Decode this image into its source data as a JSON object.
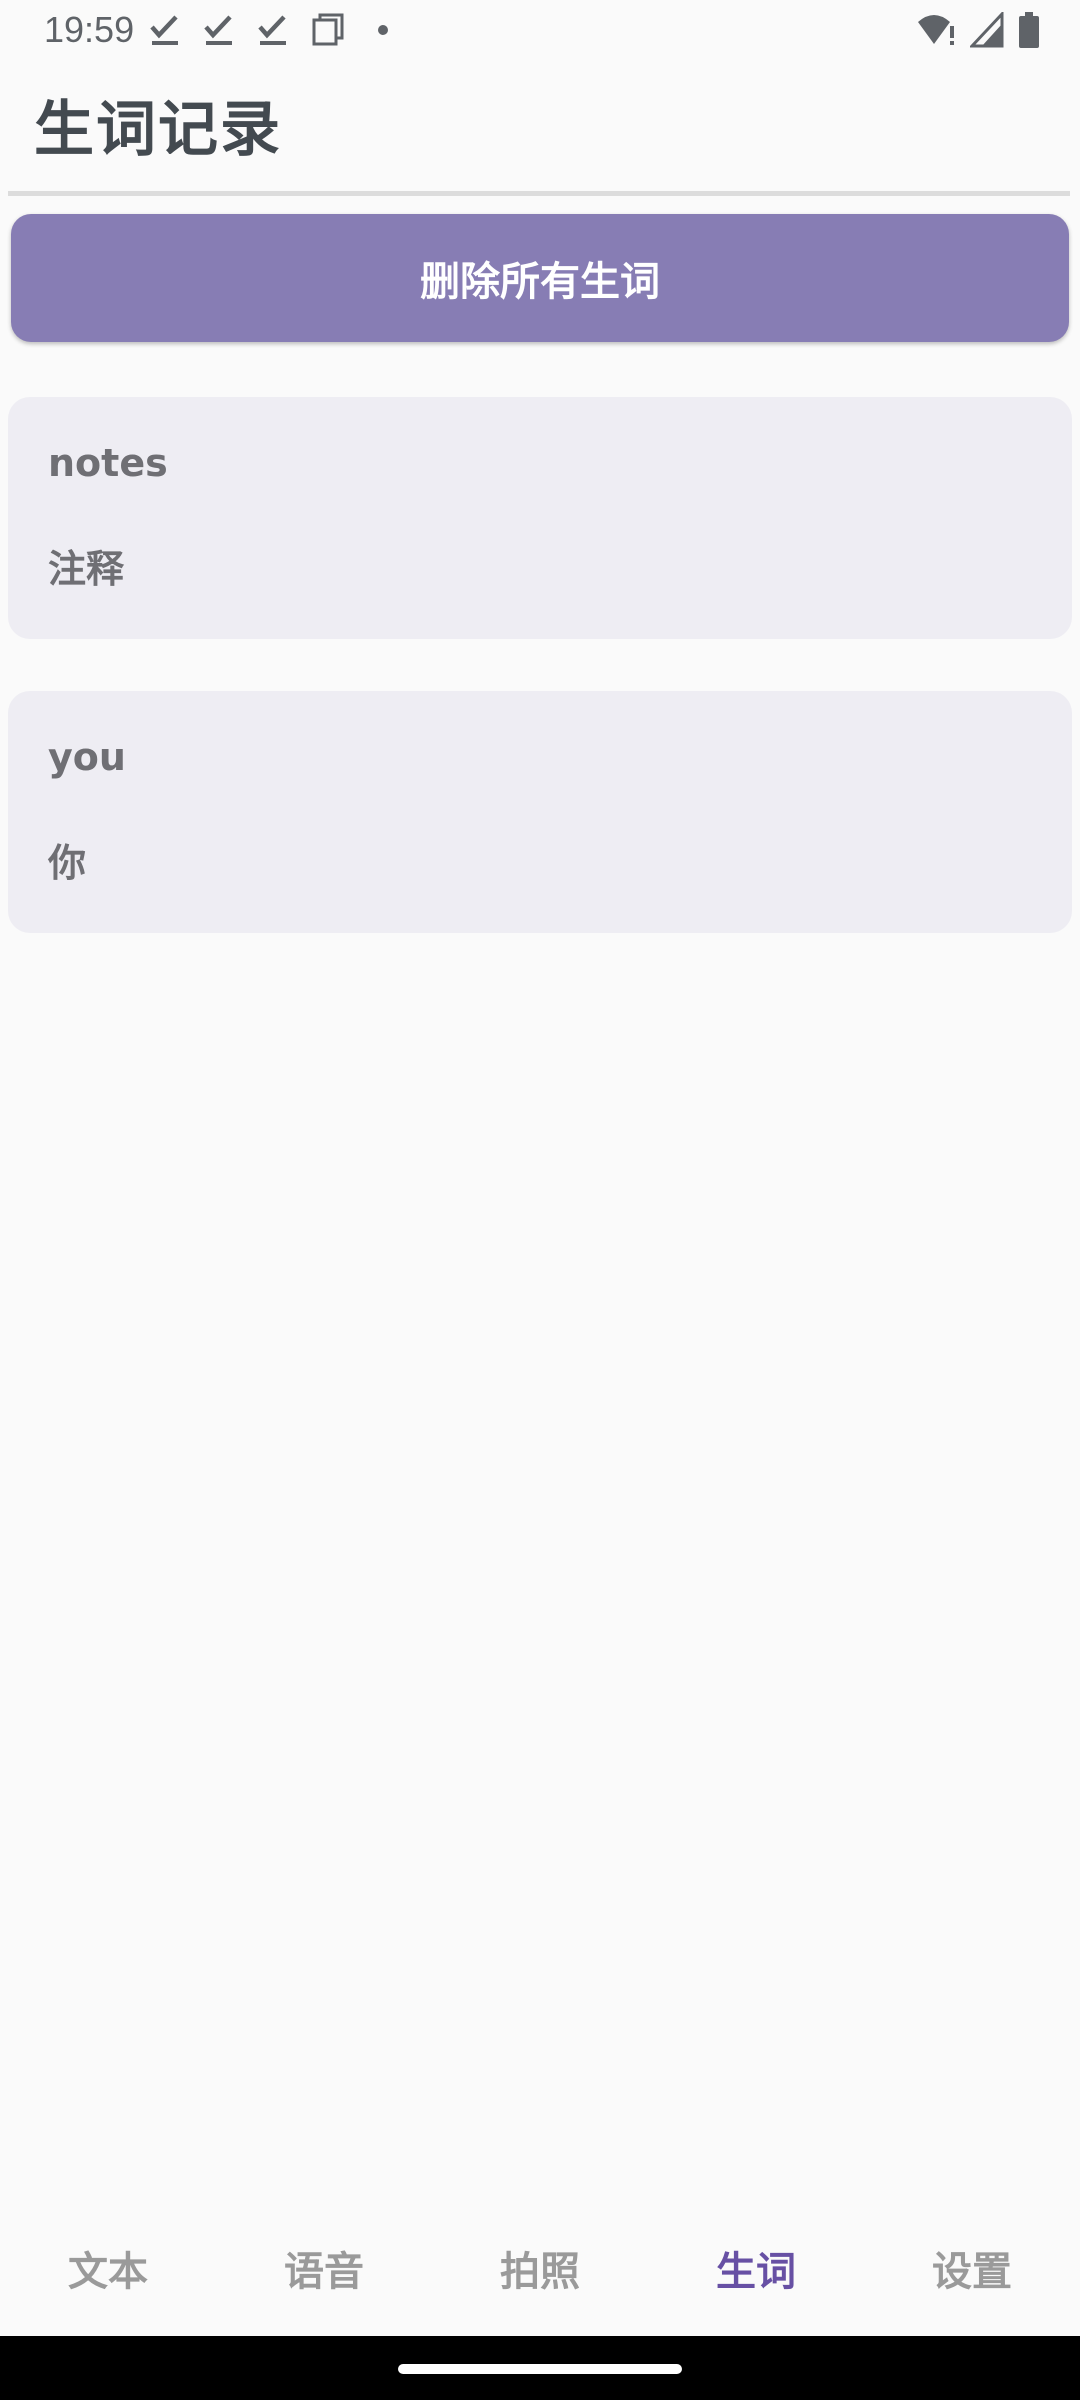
{
  "status_bar": {
    "time": "19:59",
    "left_icons": [
      "download-done-icon",
      "download-done-icon",
      "download-done-icon",
      "copy-icon",
      "dot-icon"
    ],
    "right_icons": [
      "wifi-alert-icon",
      "signal-icon",
      "battery-icon"
    ]
  },
  "header": {
    "title": "生词记录"
  },
  "actions": {
    "delete_all_label": "删除所有生词"
  },
  "words": [
    {
      "term": "notes",
      "meaning": "注释"
    },
    {
      "term": "you",
      "meaning": "你"
    }
  ],
  "bottom_nav": {
    "items": [
      {
        "label": "文本",
        "active": false
      },
      {
        "label": "语音",
        "active": false
      },
      {
        "label": "拍照",
        "active": false
      },
      {
        "label": "生词",
        "active": true
      },
      {
        "label": "设置",
        "active": false
      }
    ]
  },
  "colors": {
    "accent": "#6750a4",
    "button": "#877db4",
    "card": "#eeedf3",
    "background": "#fafafa"
  }
}
